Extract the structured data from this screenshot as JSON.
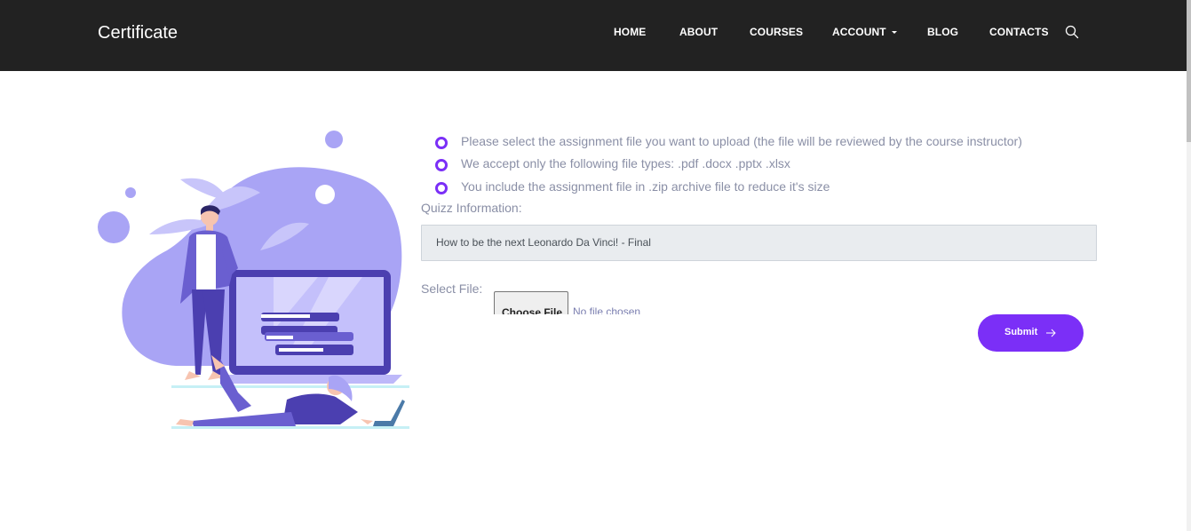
{
  "header": {
    "brand": "Certificate",
    "nav": [
      {
        "label": "HOME"
      },
      {
        "label": "ABOUT"
      },
      {
        "label": "COURSES"
      },
      {
        "label": "ACCOUNT",
        "dropdown": true
      },
      {
        "label": "BLOG"
      },
      {
        "label": "CONTACTS"
      }
    ],
    "search_icon": "search-icon"
  },
  "instructions": [
    "Please select the assignment file you want to upload (the file will be reviewed by the course instructor)",
    "We accept only the following file types: .pdf .docx .pptx .xlsx",
    "You include the assignment file in .zip archive file to reduce it's size"
  ],
  "form": {
    "quiz_label": "Quizz Information:",
    "quiz_value": "How to be the next Leonardo Da Vinci! - Final",
    "file_label": "Select File:",
    "choose_file_label": "Choose File",
    "no_file_text": "No file chosen",
    "submit_label": "Submit",
    "submit_icon": "arrow-right-icon"
  },
  "colors": {
    "header_bg": "#222222",
    "accent": "#7b2ff7",
    "illustration_primary": "#a9a4f5",
    "illustration_dark": "#4b3fb0",
    "muted_text": "#8a8fa6"
  }
}
